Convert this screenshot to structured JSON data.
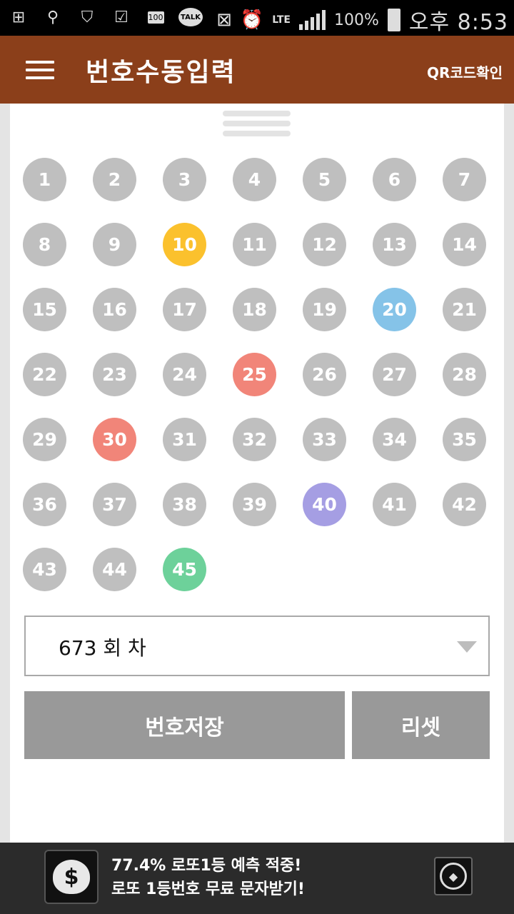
{
  "status_bar": {
    "talk_label": "TALK",
    "battery_label": "100",
    "network": "LTE",
    "battery_percent": "100%",
    "time": "오후 8:53"
  },
  "app_bar": {
    "title": "번호수동입력",
    "qr_button": "QR코드확인"
  },
  "balls": [
    {
      "n": "1",
      "color": "#bfbfbf"
    },
    {
      "n": "2",
      "color": "#bfbfbf"
    },
    {
      "n": "3",
      "color": "#bfbfbf"
    },
    {
      "n": "4",
      "color": "#bfbfbf"
    },
    {
      "n": "5",
      "color": "#bfbfbf"
    },
    {
      "n": "6",
      "color": "#bfbfbf"
    },
    {
      "n": "7",
      "color": "#bfbfbf"
    },
    {
      "n": "8",
      "color": "#bfbfbf"
    },
    {
      "n": "9",
      "color": "#bfbfbf"
    },
    {
      "n": "10",
      "color": "#fbc12d"
    },
    {
      "n": "11",
      "color": "#bfbfbf"
    },
    {
      "n": "12",
      "color": "#bfbfbf"
    },
    {
      "n": "13",
      "color": "#bfbfbf"
    },
    {
      "n": "14",
      "color": "#bfbfbf"
    },
    {
      "n": "15",
      "color": "#bfbfbf"
    },
    {
      "n": "16",
      "color": "#bfbfbf"
    },
    {
      "n": "17",
      "color": "#bfbfbf"
    },
    {
      "n": "18",
      "color": "#bfbfbf"
    },
    {
      "n": "19",
      "color": "#bfbfbf"
    },
    {
      "n": "20",
      "color": "#85c3e8"
    },
    {
      "n": "21",
      "color": "#bfbfbf"
    },
    {
      "n": "22",
      "color": "#bfbfbf"
    },
    {
      "n": "23",
      "color": "#bfbfbf"
    },
    {
      "n": "24",
      "color": "#bfbfbf"
    },
    {
      "n": "25",
      "color": "#f18579"
    },
    {
      "n": "26",
      "color": "#bfbfbf"
    },
    {
      "n": "27",
      "color": "#bfbfbf"
    },
    {
      "n": "28",
      "color": "#bfbfbf"
    },
    {
      "n": "29",
      "color": "#bfbfbf"
    },
    {
      "n": "30",
      "color": "#f18579"
    },
    {
      "n": "31",
      "color": "#bfbfbf"
    },
    {
      "n": "32",
      "color": "#bfbfbf"
    },
    {
      "n": "33",
      "color": "#bfbfbf"
    },
    {
      "n": "34",
      "color": "#bfbfbf"
    },
    {
      "n": "35",
      "color": "#bfbfbf"
    },
    {
      "n": "36",
      "color": "#bfbfbf"
    },
    {
      "n": "37",
      "color": "#bfbfbf"
    },
    {
      "n": "38",
      "color": "#bfbfbf"
    },
    {
      "n": "39",
      "color": "#bfbfbf"
    },
    {
      "n": "40",
      "color": "#a59ee3"
    },
    {
      "n": "41",
      "color": "#bfbfbf"
    },
    {
      "n": "42",
      "color": "#bfbfbf"
    },
    {
      "n": "43",
      "color": "#bfbfbf"
    },
    {
      "n": "44",
      "color": "#bfbfbf"
    },
    {
      "n": "45",
      "color": "#6dd19a"
    }
  ],
  "round_select": {
    "value": "673 회 차"
  },
  "buttons": {
    "save": "번호저장",
    "reset": "리셋"
  },
  "ad": {
    "line1": "77.4% 로또1등 예측 적중!",
    "line2": "로또 1등번호 무료 문자받기!"
  },
  "colors": {
    "app_bar": "#8b3f1a",
    "ball_default": "#bfbfbf",
    "button": "#999999"
  }
}
